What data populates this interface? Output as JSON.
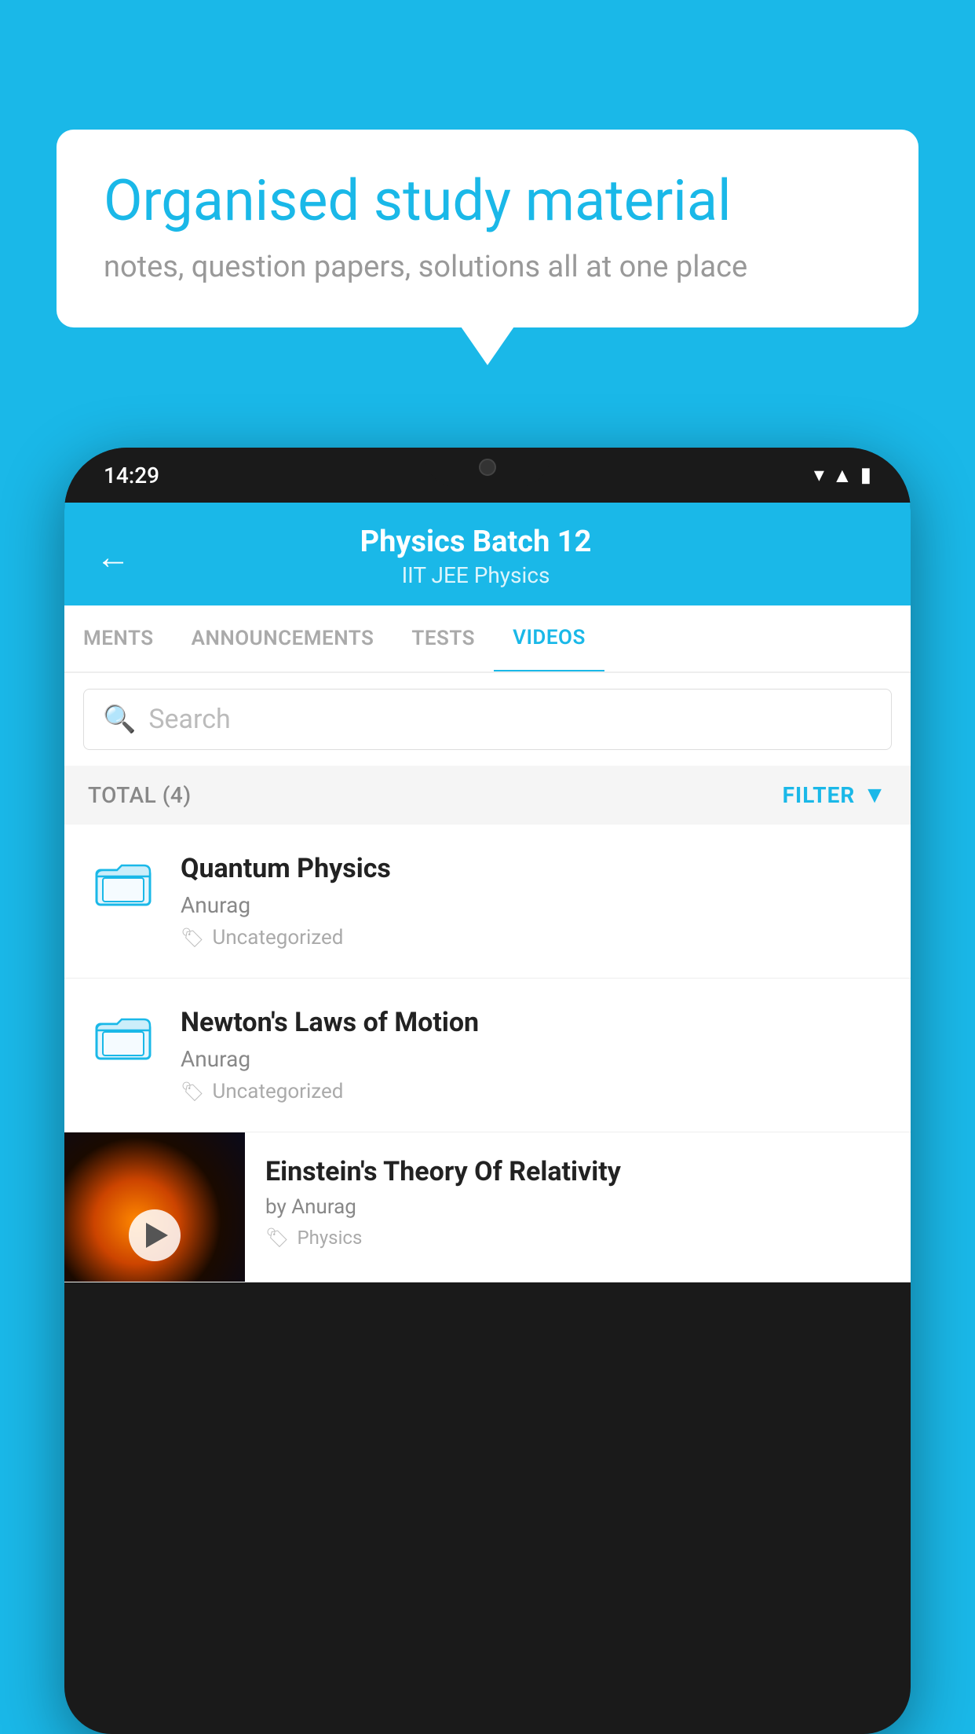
{
  "background_color": "#1ab8e8",
  "bubble": {
    "title": "Organised study material",
    "subtitle": "notes, question papers, solutions all at one place"
  },
  "phone": {
    "status_time": "14:29",
    "header": {
      "title": "Physics Batch 12",
      "subtitle": "IIT JEE   Physics",
      "back_label": "←"
    },
    "tabs": [
      {
        "label": "MENTS",
        "active": false
      },
      {
        "label": "ANNOUNCEMENTS",
        "active": false
      },
      {
        "label": "TESTS",
        "active": false
      },
      {
        "label": "VIDEOS",
        "active": true
      }
    ],
    "search": {
      "placeholder": "Search"
    },
    "filter": {
      "total_label": "TOTAL (4)",
      "button_label": "FILTER"
    },
    "list_items": [
      {
        "id": 1,
        "title": "Quantum Physics",
        "author": "Anurag",
        "tag": "Uncategorized",
        "type": "folder"
      },
      {
        "id": 2,
        "title": "Newton's Laws of Motion",
        "author": "Anurag",
        "tag": "Uncategorized",
        "type": "folder"
      },
      {
        "id": 3,
        "title": "Einstein's Theory Of Relativity",
        "author": "by Anurag",
        "tag": "Physics",
        "type": "video"
      }
    ]
  }
}
